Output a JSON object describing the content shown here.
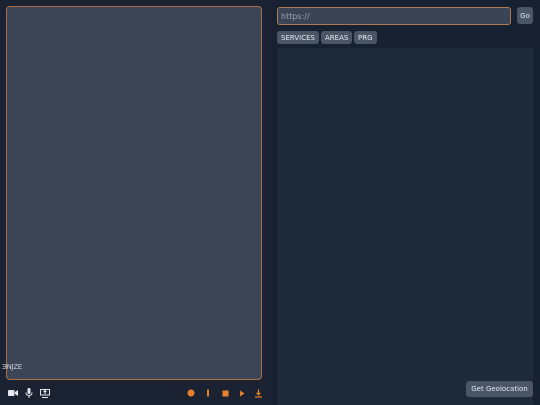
{
  "left": {
    "mode_label": "ЭNJZE",
    "media_controls": [
      {
        "name": "camera-icon"
      },
      {
        "name": "microphone-icon"
      },
      {
        "name": "screen-share-icon"
      }
    ],
    "recording_controls": [
      {
        "name": "record-icon"
      },
      {
        "name": "pause-icon"
      },
      {
        "name": "stop-icon"
      },
      {
        "name": "play-icon"
      },
      {
        "name": "download-icon"
      }
    ]
  },
  "right": {
    "url_placeholder": "https://",
    "go_label": "Go",
    "tabs": [
      {
        "label": "SERVICES"
      },
      {
        "label": "AREAS"
      },
      {
        "label": "PRG"
      }
    ],
    "geolocation_label": "Get Geolocation"
  },
  "colors": {
    "accent": "#e8822a",
    "frame_border": "#a8704a",
    "button_bg": "#4a5566"
  }
}
